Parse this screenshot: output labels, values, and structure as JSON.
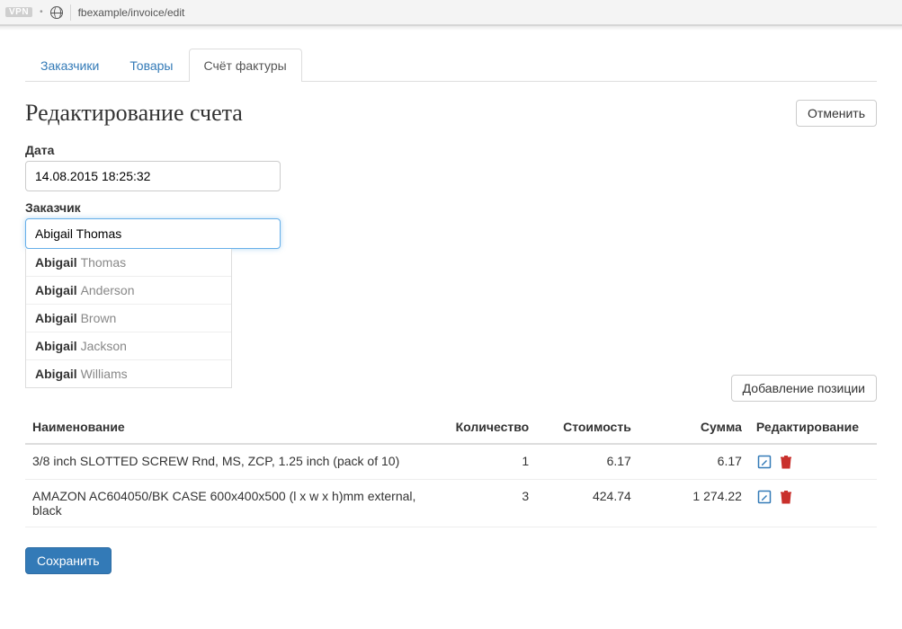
{
  "browser": {
    "vpn_label": "VPN",
    "url": "fbexample/invoice/edit"
  },
  "tabs": [
    {
      "label": "Заказчики",
      "active": false
    },
    {
      "label": "Товары",
      "active": false
    },
    {
      "label": "Счёт фактуры",
      "active": true
    }
  ],
  "page_title": "Редактирование счета",
  "buttons": {
    "cancel": "Отменить",
    "add_position": "Добавление позиции",
    "save": "Сохранить"
  },
  "form": {
    "date_label": "Дата",
    "date_value": "14.08.2015 18:25:32",
    "customer_label": "Заказчик",
    "customer_value": "Abigail Thomas",
    "customer_match": "Abigail ",
    "suggestions": [
      {
        "match": "Abigail ",
        "rest": "Thomas"
      },
      {
        "match": "Abigail ",
        "rest": "Anderson"
      },
      {
        "match": "Abigail ",
        "rest": "Brown"
      },
      {
        "match": "Abigail ",
        "rest": "Jackson"
      },
      {
        "match": "Abigail ",
        "rest": "Williams"
      }
    ]
  },
  "table": {
    "headers": {
      "name": "Наименование",
      "qty": "Количество",
      "price": "Стоимость",
      "sum": "Сумма",
      "edit": "Редактирование"
    },
    "rows": [
      {
        "name": "3/8 inch SLOTTED SCREW Rnd, MS, ZCP, 1.25 inch (pack of 10)",
        "qty": "1",
        "price": "6.17",
        "sum": "6.17"
      },
      {
        "name": "AMAZON AC604050/BK CASE 600x400x500 (l x w x h)mm external, black",
        "qty": "3",
        "price": "424.74",
        "sum": "1 274.22"
      }
    ]
  },
  "colors": {
    "primary": "#337ab7",
    "danger": "#c9302c"
  }
}
